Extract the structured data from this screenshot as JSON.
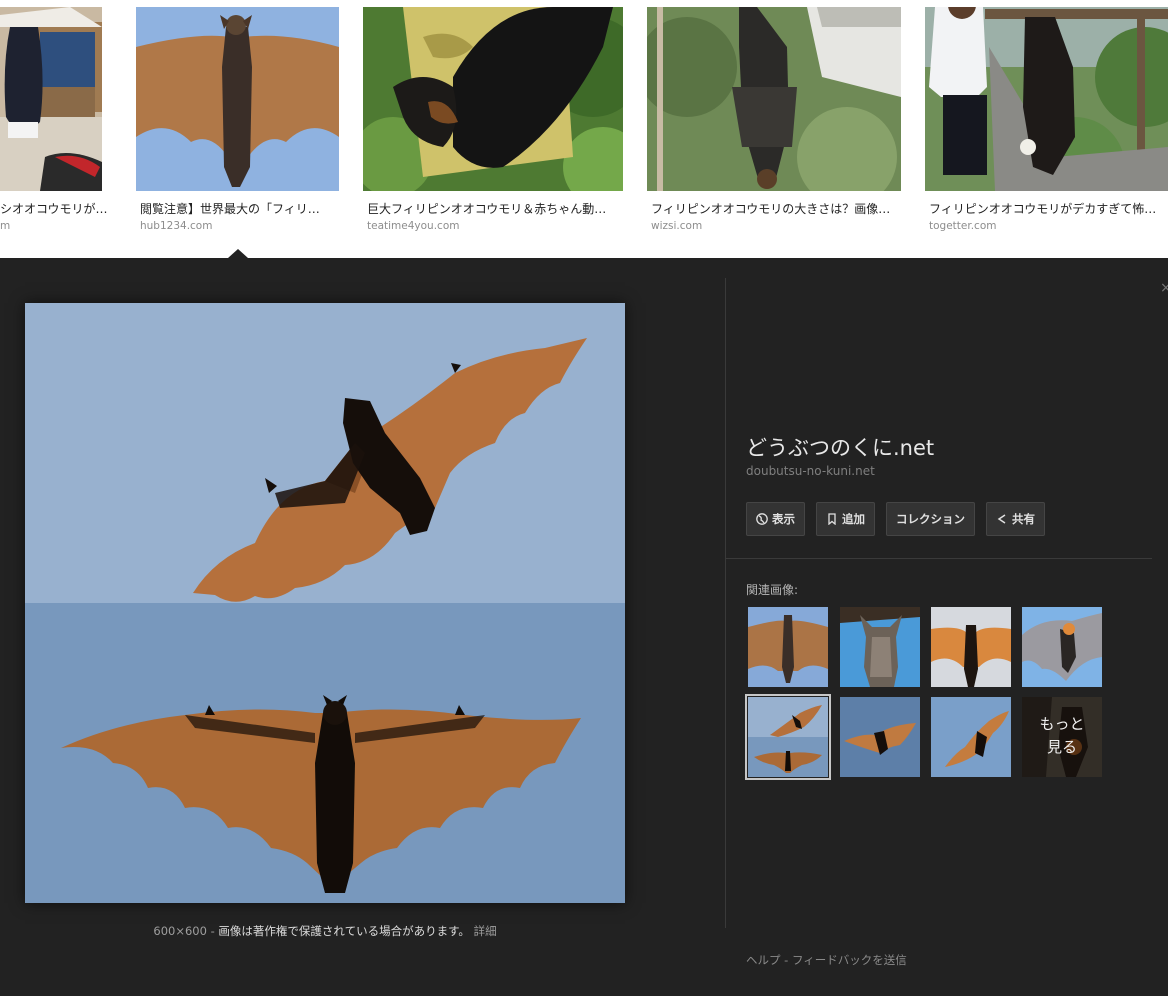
{
  "results": [
    {
      "title": "シオオコウモリが…",
      "source": "m"
    },
    {
      "title": "閲覧注意】世界最大の「フィリ…",
      "source": "hub1234.com"
    },
    {
      "title": "巨大フィリピンオオコウモリ＆赤ちゃん動…",
      "source": "teatime4you.com"
    },
    {
      "title": "フィリピンオオコウモリの大きさは？画像…",
      "source": "wizsi.com"
    },
    {
      "title": "フィリピンオオコウモリがデカすぎて怖い…",
      "source": "togetter.com"
    }
  ],
  "viewer": {
    "site_title": "どうぶつのくに.net",
    "site_domain": "doubutsu-no-kuni.net",
    "actions": {
      "view": "表示",
      "add": "追加",
      "collection": "コレクション",
      "share": "共有"
    },
    "related_label": "関連画像:",
    "more_label_line1": "もっと",
    "more_label_line2": "見る",
    "caption": {
      "dimensions": "600×600",
      "separator": "-",
      "copyright": "画像は著作権で保護されている場合があります。",
      "details": "詳細"
    },
    "footer": {
      "help": "ヘルプ",
      "separator": "-",
      "feedback": "フィードバックを送信"
    }
  },
  "icons": {
    "view": "globe-icon",
    "add": "bookmark-icon",
    "share": "share-icon"
  },
  "colors": {
    "viewer_bg": "#222222",
    "sky_top": "#98b1cf",
    "sky_bottom": "#7898bd",
    "wing": "#b06e3a"
  }
}
